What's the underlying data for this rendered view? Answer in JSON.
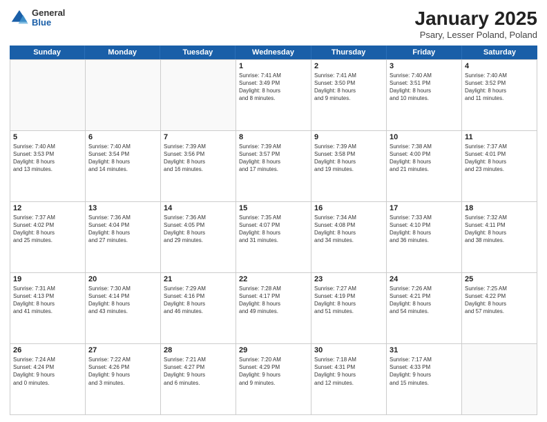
{
  "header": {
    "logo": {
      "general": "General",
      "blue": "Blue"
    },
    "title": "January 2025",
    "location": "Psary, Lesser Poland, Poland"
  },
  "weekdays": [
    "Sunday",
    "Monday",
    "Tuesday",
    "Wednesday",
    "Thursday",
    "Friday",
    "Saturday"
  ],
  "weeks": [
    [
      {
        "day": "",
        "empty": true
      },
      {
        "day": "",
        "empty": true
      },
      {
        "day": "",
        "empty": true
      },
      {
        "day": "1",
        "info": "Sunrise: 7:41 AM\nSunset: 3:49 PM\nDaylight: 8 hours\nand 8 minutes."
      },
      {
        "day": "2",
        "info": "Sunrise: 7:41 AM\nSunset: 3:50 PM\nDaylight: 8 hours\nand 9 minutes."
      },
      {
        "day": "3",
        "info": "Sunrise: 7:40 AM\nSunset: 3:51 PM\nDaylight: 8 hours\nand 10 minutes."
      },
      {
        "day": "4",
        "info": "Sunrise: 7:40 AM\nSunset: 3:52 PM\nDaylight: 8 hours\nand 11 minutes."
      }
    ],
    [
      {
        "day": "5",
        "info": "Sunrise: 7:40 AM\nSunset: 3:53 PM\nDaylight: 8 hours\nand 13 minutes."
      },
      {
        "day": "6",
        "info": "Sunrise: 7:40 AM\nSunset: 3:54 PM\nDaylight: 8 hours\nand 14 minutes."
      },
      {
        "day": "7",
        "info": "Sunrise: 7:39 AM\nSunset: 3:56 PM\nDaylight: 8 hours\nand 16 minutes."
      },
      {
        "day": "8",
        "info": "Sunrise: 7:39 AM\nSunset: 3:57 PM\nDaylight: 8 hours\nand 17 minutes."
      },
      {
        "day": "9",
        "info": "Sunrise: 7:39 AM\nSunset: 3:58 PM\nDaylight: 8 hours\nand 19 minutes."
      },
      {
        "day": "10",
        "info": "Sunrise: 7:38 AM\nSunset: 4:00 PM\nDaylight: 8 hours\nand 21 minutes."
      },
      {
        "day": "11",
        "info": "Sunrise: 7:37 AM\nSunset: 4:01 PM\nDaylight: 8 hours\nand 23 minutes."
      }
    ],
    [
      {
        "day": "12",
        "info": "Sunrise: 7:37 AM\nSunset: 4:02 PM\nDaylight: 8 hours\nand 25 minutes."
      },
      {
        "day": "13",
        "info": "Sunrise: 7:36 AM\nSunset: 4:04 PM\nDaylight: 8 hours\nand 27 minutes."
      },
      {
        "day": "14",
        "info": "Sunrise: 7:36 AM\nSunset: 4:05 PM\nDaylight: 8 hours\nand 29 minutes."
      },
      {
        "day": "15",
        "info": "Sunrise: 7:35 AM\nSunset: 4:07 PM\nDaylight: 8 hours\nand 31 minutes."
      },
      {
        "day": "16",
        "info": "Sunrise: 7:34 AM\nSunset: 4:08 PM\nDaylight: 8 hours\nand 34 minutes."
      },
      {
        "day": "17",
        "info": "Sunrise: 7:33 AM\nSunset: 4:10 PM\nDaylight: 8 hours\nand 36 minutes."
      },
      {
        "day": "18",
        "info": "Sunrise: 7:32 AM\nSunset: 4:11 PM\nDaylight: 8 hours\nand 38 minutes."
      }
    ],
    [
      {
        "day": "19",
        "info": "Sunrise: 7:31 AM\nSunset: 4:13 PM\nDaylight: 8 hours\nand 41 minutes."
      },
      {
        "day": "20",
        "info": "Sunrise: 7:30 AM\nSunset: 4:14 PM\nDaylight: 8 hours\nand 43 minutes."
      },
      {
        "day": "21",
        "info": "Sunrise: 7:29 AM\nSunset: 4:16 PM\nDaylight: 8 hours\nand 46 minutes."
      },
      {
        "day": "22",
        "info": "Sunrise: 7:28 AM\nSunset: 4:17 PM\nDaylight: 8 hours\nand 49 minutes."
      },
      {
        "day": "23",
        "info": "Sunrise: 7:27 AM\nSunset: 4:19 PM\nDaylight: 8 hours\nand 51 minutes."
      },
      {
        "day": "24",
        "info": "Sunrise: 7:26 AM\nSunset: 4:21 PM\nDaylight: 8 hours\nand 54 minutes."
      },
      {
        "day": "25",
        "info": "Sunrise: 7:25 AM\nSunset: 4:22 PM\nDaylight: 8 hours\nand 57 minutes."
      }
    ],
    [
      {
        "day": "26",
        "info": "Sunrise: 7:24 AM\nSunset: 4:24 PM\nDaylight: 9 hours\nand 0 minutes."
      },
      {
        "day": "27",
        "info": "Sunrise: 7:22 AM\nSunset: 4:26 PM\nDaylight: 9 hours\nand 3 minutes."
      },
      {
        "day": "28",
        "info": "Sunrise: 7:21 AM\nSunset: 4:27 PM\nDaylight: 9 hours\nand 6 minutes."
      },
      {
        "day": "29",
        "info": "Sunrise: 7:20 AM\nSunset: 4:29 PM\nDaylight: 9 hours\nand 9 minutes."
      },
      {
        "day": "30",
        "info": "Sunrise: 7:18 AM\nSunset: 4:31 PM\nDaylight: 9 hours\nand 12 minutes."
      },
      {
        "day": "31",
        "info": "Sunrise: 7:17 AM\nSunset: 4:33 PM\nDaylight: 9 hours\nand 15 minutes."
      },
      {
        "day": "",
        "empty": true
      }
    ]
  ]
}
